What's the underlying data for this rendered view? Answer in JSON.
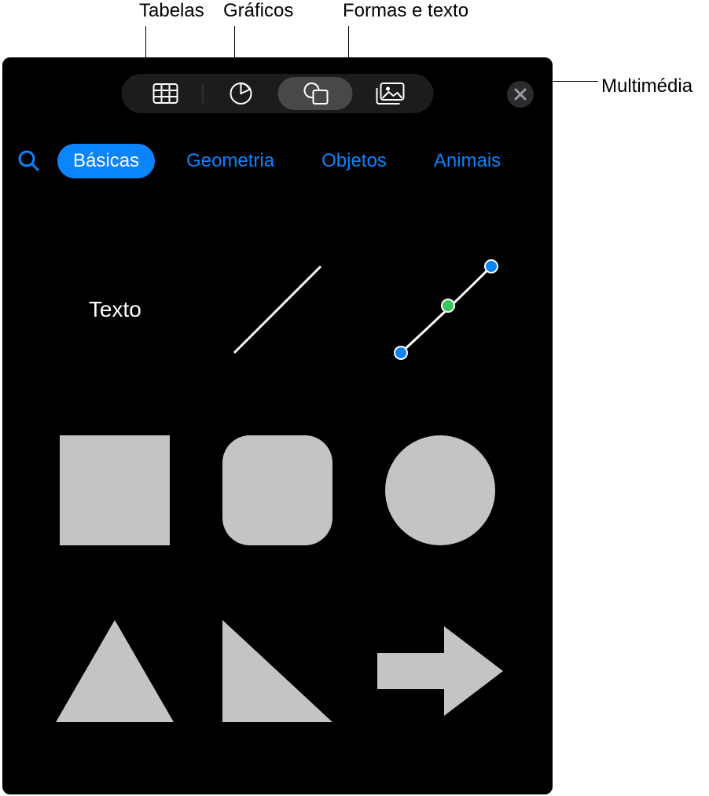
{
  "callouts": {
    "tables": "Tabelas",
    "charts": "Gráficos",
    "shapes_text": "Formas e texto",
    "media": "Multimédia"
  },
  "categories": {
    "basic": "Básicas",
    "geometry": "Geometria",
    "objects": "Objetos",
    "animals": "Animais"
  },
  "shapes": {
    "text_label": "Texto"
  },
  "colors": {
    "accent": "#0a84ff",
    "shape_fill": "#c4c4c6",
    "panel_bg": "#000000"
  }
}
